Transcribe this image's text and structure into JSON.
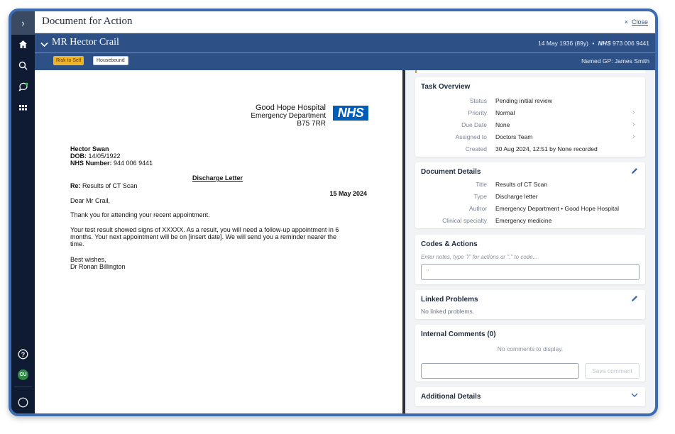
{
  "window": {
    "title": "Document for Action",
    "close_label": "Close",
    "close_x": "×"
  },
  "patient": {
    "name": "MR Hector Crail",
    "dob_age": "14 May 1936 (89y)",
    "separator": "•",
    "nhs_label": "NHS",
    "nhs_number": "973 006 9441",
    "gp": "Named GP: James Smith",
    "flags": [
      "Risk to Self",
      "Housebound"
    ]
  },
  "sidebar": {
    "expand": "›",
    "avatar": "CU"
  },
  "letter": {
    "hospital": "Good Hope Hospital",
    "department": "Emergency Department",
    "postcode": "B75 7RR",
    "nhs_logo": "NHS",
    "name": "Hector Swan",
    "dob_label": "DOB:",
    "dob": "14/05/1922",
    "nhs_label": "NHS Number:",
    "nhs_number": "944 006 9441",
    "heading": "Discharge Letter",
    "re_label": "Re:",
    "re": "Results of CT Scan",
    "date": "15 May 2024",
    "salutation": "Dear Mr Crail,",
    "para1": "Thank you for attending your recent appointment.",
    "para2_line1": "Your test result showed signs of XXXXX. As a result, you will need a follow-up appointment in 6",
    "para2_line2": "months. Your next appointment will be on [insert date]. We will send you a reminder nearer the",
    "para2_line3": "time.",
    "signoff": "Best wishes,",
    "signature": "Dr Ronan Billington"
  },
  "task_overview": {
    "title": "Task Overview",
    "rows": [
      {
        "label": "Status",
        "value": "Pending initial review"
      },
      {
        "label": "Priority",
        "value": "Normal"
      },
      {
        "label": "Due Date",
        "value": "None"
      },
      {
        "label": "Assigned to",
        "value": "Doctors Team"
      },
      {
        "label": "Created",
        "value": "30 Aug 2024, 12:51 by None recorded"
      }
    ]
  },
  "document_details": {
    "title": "Document Details",
    "rows": [
      {
        "label": "Title",
        "value": "Results of CT Scan"
      },
      {
        "label": "Type",
        "value": "Discharge letter"
      },
      {
        "label": "Author",
        "value": "Emergency Department • Good Hope Hospital"
      },
      {
        "label": "Clinical specialty",
        "value": "Emergency medicine"
      }
    ]
  },
  "codes_actions": {
    "title": "Codes & Actions",
    "placeholder": "Enter notes, type \"/\" for actions or \".\" to code...",
    "input_value": "\""
  },
  "linked_problems": {
    "title": "Linked Problems",
    "empty": "No linked problems."
  },
  "internal_comments": {
    "title": "Internal Comments (0)",
    "empty": "No comments to display.",
    "save_label": "Save comment"
  },
  "additional_details": {
    "title": "Additional Details"
  },
  "colors": {
    "frame": "#3d6bb0",
    "patient_bar": "#2d5187",
    "sidebar": "#0f1b33",
    "flag_risk": "#f0b429",
    "nhs_blue": "#005eb8"
  }
}
